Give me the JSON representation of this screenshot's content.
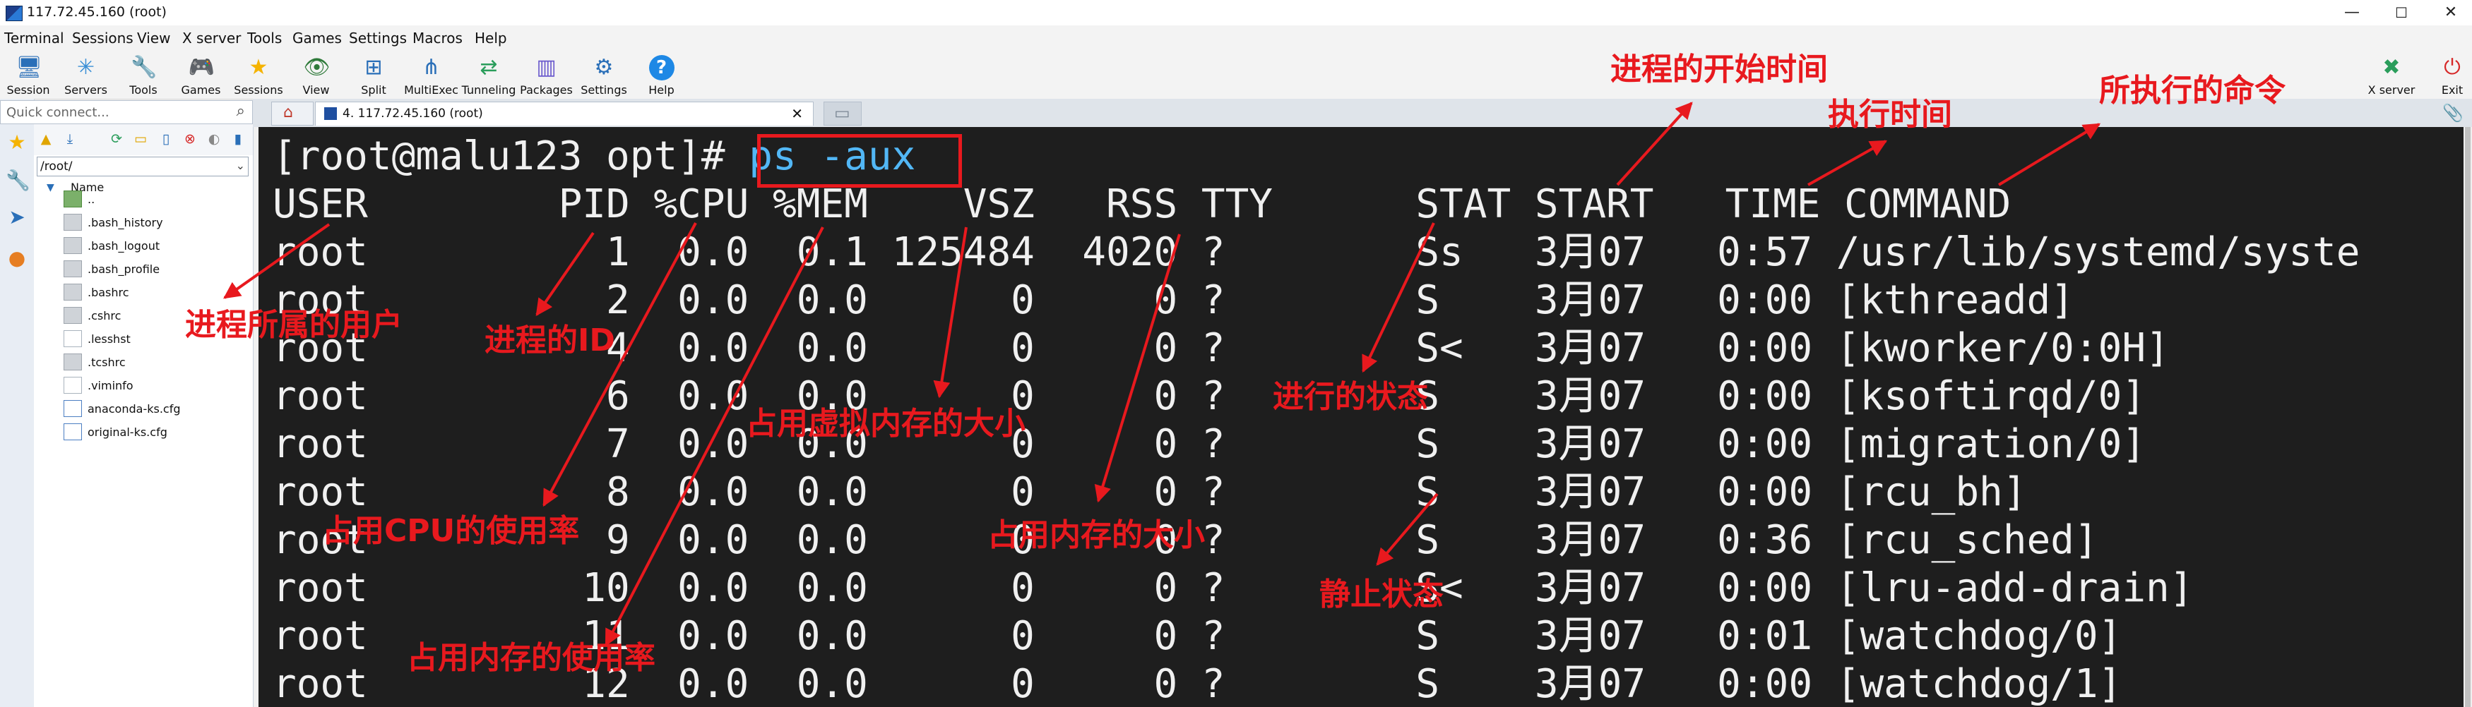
{
  "window": {
    "title": "117.72.45.160 (root)",
    "controls": [
      "—",
      "☐",
      "✕"
    ]
  },
  "menu": [
    "Terminal",
    "Sessions",
    "View",
    "X server",
    "Tools",
    "Games",
    "Settings",
    "Macros",
    "Help"
  ],
  "toolbar": [
    {
      "label": "Session",
      "icon": "monitor-icon",
      "glyph": "🖥",
      "color": "#2a6fb8"
    },
    {
      "label": "Servers",
      "icon": "servers-icon",
      "glyph": "✳",
      "color": "#3b8fd6"
    },
    {
      "label": "Tools",
      "icon": "tools-icon",
      "glyph": "🔧",
      "color": "#c0392b"
    },
    {
      "label": "Games",
      "icon": "gamepad-icon",
      "glyph": "🎮",
      "color": "#555555"
    },
    {
      "label": "Sessions",
      "icon": "star-icon",
      "glyph": "★",
      "color": "#f5b301"
    },
    {
      "label": "View",
      "icon": "view-icon",
      "glyph": "👁",
      "color": "#2f7a3a"
    },
    {
      "label": "Split",
      "icon": "split-icon",
      "glyph": "⊞",
      "color": "#2a6fb8"
    },
    {
      "label": "MultiExec",
      "icon": "multiexec-icon",
      "glyph": "⋔",
      "color": "#2a6fb8"
    },
    {
      "label": "Tunneling",
      "icon": "tunneling-icon",
      "glyph": "⇄",
      "color": "#2a9d5b"
    },
    {
      "label": "Packages",
      "icon": "packages-icon",
      "glyph": "▥",
      "color": "#6a5acd"
    },
    {
      "label": "Settings",
      "icon": "gear-icon",
      "glyph": "⚙",
      "color": "#2a6fb8"
    },
    {
      "label": "Help",
      "icon": "help-icon",
      "glyph": "?",
      "color": "#ffffff"
    }
  ],
  "toolbar_right": [
    {
      "label": "X server",
      "icon": "x-server-icon",
      "glyph": "✖",
      "color": "#2a9d5b"
    },
    {
      "label": "Exit",
      "icon": "power-icon",
      "glyph": "⏻",
      "color": "#d62828"
    }
  ],
  "quick_connect": {
    "placeholder": "Quick connect..."
  },
  "sidebar": {
    "path": "/root/",
    "column_header": "Name",
    "files": [
      {
        "name": "..",
        "type": "up"
      },
      {
        "name": ".bash_history",
        "type": "file"
      },
      {
        "name": ".bash_logout",
        "type": "file"
      },
      {
        "name": ".bash_profile",
        "type": "file"
      },
      {
        "name": ".bashrc",
        "type": "file"
      },
      {
        "name": ".cshrc",
        "type": "file"
      },
      {
        "name": ".lesshst",
        "type": "doc"
      },
      {
        "name": ".tcshrc",
        "type": "file"
      },
      {
        "name": ".viminfo",
        "type": "doc"
      },
      {
        "name": "anaconda-ks.cfg",
        "type": "cfg"
      },
      {
        "name": "original-ks.cfg",
        "type": "cfg"
      }
    ]
  },
  "tabs": [
    {
      "label": "4. 117.72.45.160 (root)",
      "close": "✕"
    }
  ],
  "terminal": {
    "prompt": "[root@malu123 opt]# ",
    "command": "ps -aux",
    "header": "USER        PID %CPU %MEM    VSZ   RSS TTY      STAT START   TIME COMMAND",
    "rows": [
      "root          1  0.0  0.1 125484  4020 ?        Ss   3月07   0:57 /usr/lib/systemd/syste",
      "root          2  0.0  0.0      0     0 ?        S    3月07   0:00 [kthreadd]",
      "root          4  0.0  0.0      0     0 ?        S<   3月07   0:00 [kworker/0:0H]",
      "root          6  0.0  0.0      0     0 ?        S    3月07   0:00 [ksoftirqd/0]",
      "root          7  0.0  0.0      0     0 ?        S    3月07   0:00 [migration/0]",
      "root          8  0.0  0.0      0     0 ?        S    3月07   0:00 [rcu_bh]",
      "root          9  0.0  0.0      0     0 ?        S    3月07   0:36 [rcu_sched]",
      "root         10  0.0  0.0      0     0 ?        S<   3月07   0:00 [lru-add-drain]",
      "root         11  0.0  0.0      0     0 ?        S    3月07   0:01 [watchdog/0]",
      "root         12  0.0  0.0      0     0 ?        S    3月07   0:00 [watchdog/1]"
    ]
  },
  "annotations": {
    "start_time": "进程的开始时间",
    "exec_time": "执行时间",
    "command": "所执行的命令",
    "user": "进程所属的用户",
    "pid": "进程的ID",
    "vsz": "占用虚拟内存的大小",
    "state": "进行的状态",
    "cpu": "占用CPU的使用率",
    "rss": "占用内存的大小",
    "stopped": "静止状态",
    "mem": "占用内存的使用率",
    "color": "#e8191e"
  }
}
